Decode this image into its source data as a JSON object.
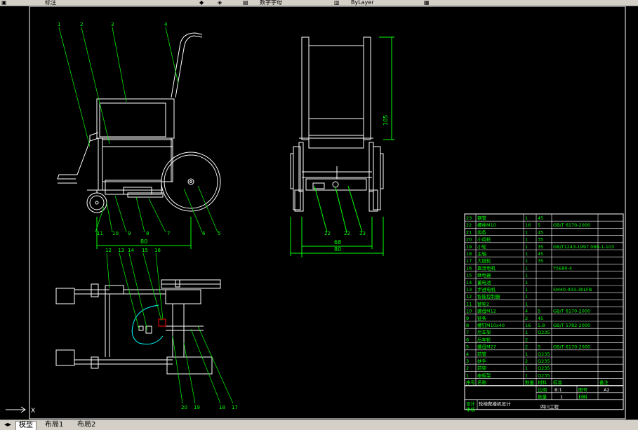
{
  "toolbar": {
    "style_label": "标注",
    "layer_label": "数字字母",
    "linetype_label": "ByLayer",
    "icon_names": [
      "folder-icon",
      "dimension-style-icon",
      "text-style-icon",
      "layer-icon",
      "color-icon"
    ]
  },
  "tabs": [
    {
      "label": "模型"
    },
    {
      "label": "布局1"
    },
    {
      "label": "布局2"
    }
  ],
  "dims": {
    "side_width": "80",
    "front_inner": "68",
    "front_outer": "80",
    "front_height": "105"
  },
  "side_callouts": [
    "1",
    "2",
    "3",
    "4",
    "11",
    "10",
    "9",
    "8",
    "7",
    "6",
    "5"
  ],
  "front_callouts": [
    "22",
    "22",
    "23"
  ],
  "plan_callouts_top": [
    "12",
    "13",
    "14",
    "15",
    "16"
  ],
  "plan_callouts_bottom": [
    "20",
    "19",
    "18",
    "17"
  ],
  "bom": {
    "rows": [
      {
        "no": "23",
        "name": "钢管",
        "qty": "1",
        "mat": "45",
        "std": "",
        "note": ""
      },
      {
        "no": "22",
        "name": "螺栓M10",
        "qty": "16",
        "mat": "5",
        "std": "GB/T 6170-2000",
        "note": ""
      },
      {
        "no": "21",
        "name": "齿条",
        "qty": "1",
        "mat": "45",
        "std": "",
        "note": ""
      },
      {
        "no": "20",
        "name": "小齿轮",
        "qty": "1",
        "mat": "35",
        "std": "",
        "note": ""
      },
      {
        "no": "19",
        "name": "小轮",
        "qty": "1",
        "mat": "35",
        "std": "GB/T1243-1997 06B-1-103",
        "note": ""
      },
      {
        "no": "18",
        "name": "主轴",
        "qty": "1",
        "mat": "45",
        "std": "",
        "note": ""
      },
      {
        "no": "17",
        "name": "大链轮",
        "qty": "1",
        "mat": "35",
        "std": "",
        "note": ""
      },
      {
        "no": "16",
        "name": "直流电机",
        "qty": "1",
        "mat": "",
        "std": "Y5E80-4",
        "note": ""
      },
      {
        "no": "15",
        "name": "继电器",
        "qty": "1",
        "mat": "",
        "std": "",
        "note": ""
      },
      {
        "no": "14",
        "name": "蓄电池",
        "qty": "1",
        "mat": "",
        "std": "",
        "note": ""
      },
      {
        "no": "13",
        "name": "步进电机",
        "qty": "1",
        "mat": "",
        "std": "5M40-003-30LFB",
        "note": ""
      },
      {
        "no": "12",
        "name": "智能控制器",
        "qty": "1",
        "mat": "",
        "std": "",
        "note": ""
      },
      {
        "no": "11",
        "name": "链轮2",
        "qty": "1",
        "mat": "",
        "std": "",
        "note": ""
      },
      {
        "no": "10",
        "name": "螺母M12",
        "qty": "4",
        "mat": "5",
        "std": "GB/T 6170-2000",
        "note": ""
      },
      {
        "no": "9",
        "name": "链条",
        "qty": "2",
        "mat": "45",
        "std": "",
        "note": ""
      },
      {
        "no": "8",
        "name": "螺钉M10x40",
        "qty": "16",
        "mat": "5.8",
        "std": "GB/T 5782-2000",
        "note": ""
      },
      {
        "no": "7",
        "name": "后车架",
        "qty": "1",
        "mat": "Q235",
        "std": "",
        "note": ""
      },
      {
        "no": "6",
        "name": "后车轮",
        "qty": "2",
        "mat": "",
        "std": "",
        "note": ""
      },
      {
        "no": "5",
        "name": "螺母M27",
        "qty": "2",
        "mat": "5",
        "std": "GB/T 6170-2000",
        "note": ""
      },
      {
        "no": "4",
        "name": "前管",
        "qty": "1",
        "mat": "Q235",
        "std": "",
        "note": ""
      },
      {
        "no": "3",
        "name": "扶手",
        "qty": "2",
        "mat": "Q235",
        "std": "",
        "note": ""
      },
      {
        "no": "2",
        "name": "前架",
        "qty": "1",
        "mat": "Q235",
        "std": "",
        "note": ""
      },
      {
        "no": "1",
        "name": "座板架",
        "qty": "1",
        "mat": "Q235",
        "std": "",
        "note": ""
      }
    ],
    "header": {
      "no": "序号",
      "name": "名称",
      "qty": "数量",
      "mat": "材料",
      "std": "标准",
      "note": "备注"
    },
    "title_block": {
      "scale_label": "比例",
      "scale": "B:1",
      "sheet_label": "图号",
      "sheet": "A2",
      "qty_label": "数量",
      "qty": "1",
      "mat_label": "材料",
      "designer_label": "设计",
      "title": "轮椅爬楼机设计",
      "check_label": "审核",
      "school": "四川工程"
    }
  },
  "colors": {
    "line": "#ffffff",
    "callout": "#00ff00",
    "dim": "#00ff00",
    "cyan": "#00ffff",
    "red": "#ff0000",
    "toolbar": "#d4d0c8"
  }
}
